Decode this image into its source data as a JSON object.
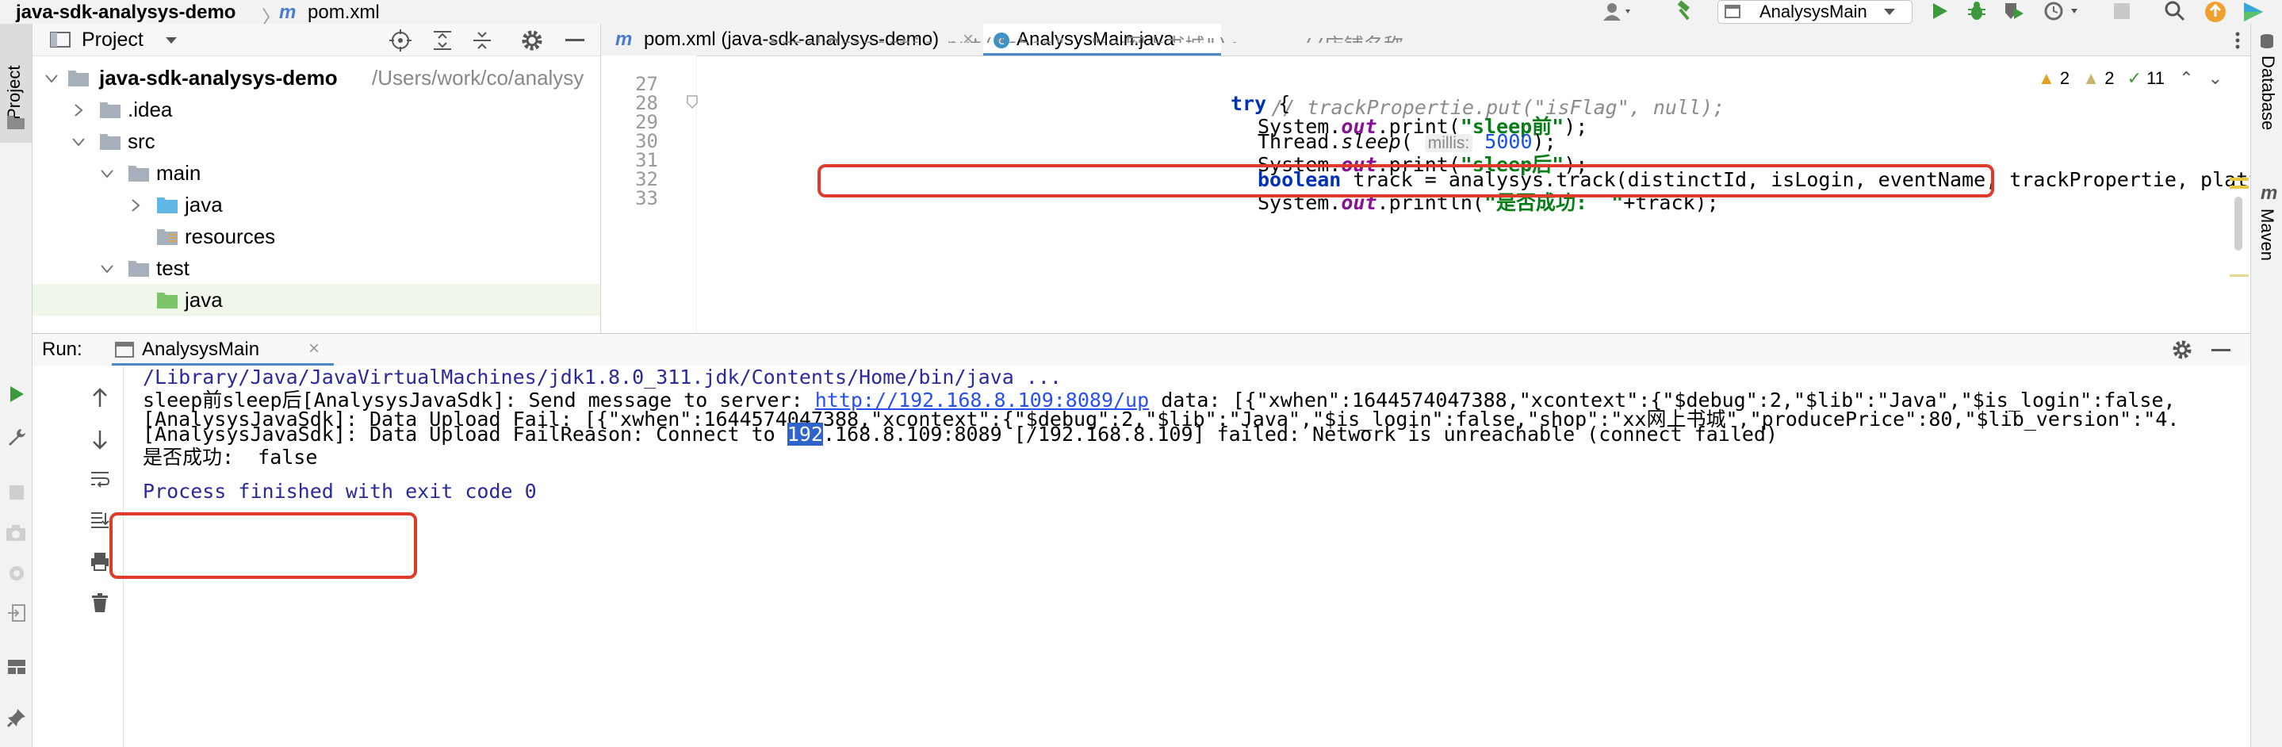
{
  "navbar": {
    "project_name": "java-sdk-analysys-demo",
    "separator": "〉",
    "file_name": "pom.xml",
    "run_config": "AnalysysMain"
  },
  "left_strip": {
    "project_label": "Project"
  },
  "right_strip": {
    "database_label": "Database",
    "maven_label": "Maven"
  },
  "project_panel": {
    "title": "Project",
    "tree": [
      {
        "label": "java-sdk-analysys-demo",
        "path": "/Users/work/co/analysy"
      },
      {
        "label": ".idea"
      },
      {
        "label": "src"
      },
      {
        "label": "main"
      },
      {
        "label": "java"
      },
      {
        "label": "resources"
      },
      {
        "label": "test"
      },
      {
        "label": "java"
      }
    ]
  },
  "editor": {
    "tabs": [
      {
        "label": "pom.xml (java-sdk-analysys-demo)"
      },
      {
        "label": "AnalysysMain.java"
      }
    ],
    "inspections": {
      "warnings": "2",
      "weak_warnings": "2",
      "typos": "11"
    },
    "lines": [
      {
        "number": "27",
        "comment": "// trackPropertie.put(\"isFlag\", null);"
      },
      {
        "number": "28",
        "kw": "try",
        "rest": " {"
      },
      {
        "number": "29",
        "pre": "System.",
        "field": "out",
        "mid": ".print(",
        "str": "\"sleep前\"",
        "post": ");"
      },
      {
        "number": "30",
        "pre": "Thread.",
        "method": "sleep",
        "mid": "( ",
        "hint": "millis:",
        "num": "5000",
        "post": ");"
      },
      {
        "number": "31",
        "pre": "System.",
        "field": "out",
        "mid": ".print(",
        "str": "\"sleep后\"",
        "post": ");"
      },
      {
        "number": "32",
        "kw": "boolean",
        "rest": " track = analysys.track(distinctId, isLogin, eventName, trackPropertie, platform);"
      },
      {
        "number": "33",
        "pre": "System.",
        "field": "out",
        "mid": ".println(",
        "str": "\"是否成功:  \"",
        "post": "+track);"
      }
    ]
  },
  "run_panel": {
    "label": "Run:",
    "tab": "AnalysysMain",
    "console": {
      "line1": "/Library/Java/JavaVirtualMachines/jdk1.8.0_311.jdk/Contents/Home/bin/java ...",
      "line2_pre": "sleep前sleep后[AnalysysJavaSdk]: Send message to server: ",
      "line2_link": "http://192.168.8.109:8089/up",
      "line2_post": " data: [{\"xwhen\":1644574047388,\"xcontext\":{\"$debug\":2,\"$lib\":\"Java\",\"$is_login\":false,",
      "line3": "[AnalysysJavaSdk]: Data Upload Fail: [{\"xwhen\":1644574047388,\"xcontext\":{\"$debug\":2,\"$lib\":\"Java\",\"$is_login\":false,\"shop\":\"xx网上书城\",\"producePrice\":80,\"$lib_version\":\"4.",
      "line4_pre": "[AnalysysJavaSdk]: Data Upload FailReason: Connect to ",
      "line4_sel": "192",
      "line4_post": ".168.8.109:8089 [/192.168.8.109] failed: Network is unreachable (connect failed)",
      "line5": "是否成功:  false",
      "line6": "Process finished with exit code 0"
    }
  },
  "colors": {
    "highlight": "#e03a2b",
    "selection": "#2f65ca",
    "link": "#2a4ff0"
  }
}
